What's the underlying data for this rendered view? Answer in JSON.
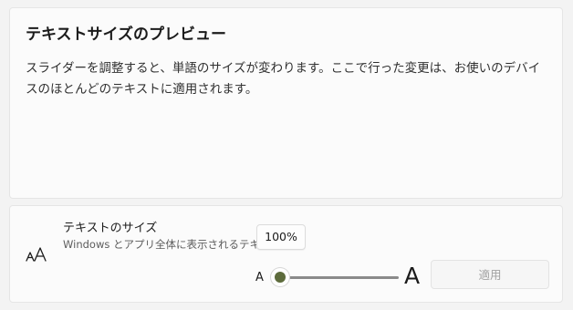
{
  "preview": {
    "title": "テキストサイズのプレビュー",
    "text": "スライダーを調整すると、単語のサイズが変わります。ここで行った変更は、お使いのデバイスのほとんどのテキストに適用されます。"
  },
  "text_size_setting": {
    "icon": "text-size-icon",
    "title": "テキストのサイズ",
    "description": "Windows とアプリ全体に表示されるテキスト",
    "value_label": "100%",
    "slider_value_percent": 100,
    "slider_min_label": "A",
    "slider_max_label": "A",
    "apply_label": "適用",
    "apply_enabled": false
  },
  "colors": {
    "accent": "#5d6b3c",
    "background": "#f3f3f3",
    "card": "#fbfbfb",
    "disabled_text": "#a2a2a2"
  }
}
